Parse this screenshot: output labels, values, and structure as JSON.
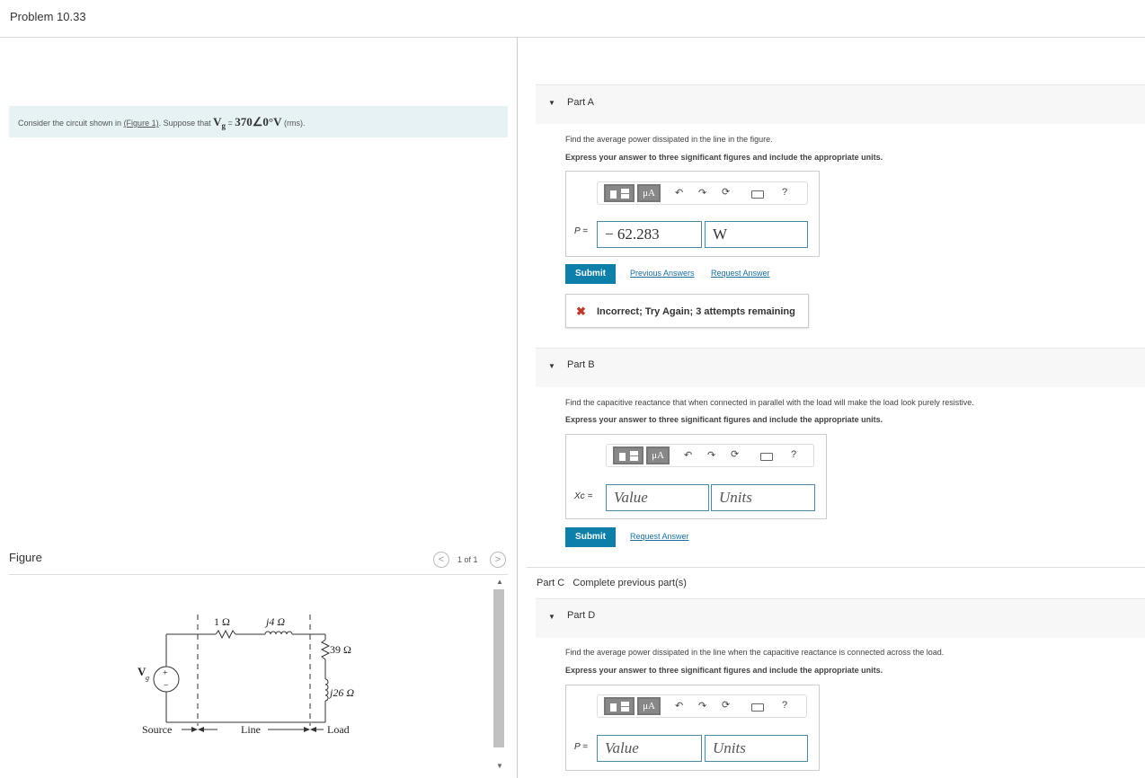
{
  "page": {
    "title": "Problem 10.33"
  },
  "problem": {
    "prefix": "Consider the circuit shown in ",
    "figure_link": "(Figure 1)",
    "middle": ". Suppose that ",
    "vg_symbol": "V",
    "vg_sub": "g",
    "equals": " = ",
    "vg_value": "370∠0°V",
    "suffix": " (rms)."
  },
  "figure": {
    "title": "Figure",
    "count": "1 of 1",
    "circuit": {
      "r1": "1 Ω",
      "x1": "j4 Ω",
      "r2": "39 Ω",
      "x2": "j26 Ω",
      "vg": "V",
      "vg_sub": "g",
      "plus": "+",
      "minus": "−",
      "source": "Source",
      "line": "Line",
      "load": "Load"
    }
  },
  "icons": {
    "prev": "chevron-left-icon",
    "next": "chevron-right-icon",
    "undo": "undo-icon",
    "redo": "redo-icon",
    "reset": "reset-icon",
    "keyboard": "keyboard-icon",
    "help": "help-icon",
    "templates": "templates-icon",
    "units": "units-icon"
  },
  "toolbar": {
    "mu_label": "μA",
    "help_label": "?"
  },
  "partA": {
    "label": "Part A",
    "question": "Find the average power dissipated in the line in the figure.",
    "instruction": "Express your answer to three significant figures and include the appropriate units.",
    "var_label": "P =",
    "value": "− 62.283",
    "units": "W",
    "submit": "Submit",
    "previous_answers": "Previous Answers",
    "request_answer": "Request Answer",
    "feedback_icon": "✖",
    "feedback": "Incorrect; Try Again; 3 attempts remaining"
  },
  "partB": {
    "label": "Part B",
    "question": "Find the capacitive reactance that when connected in parallel with the load will make the load look purely resistive.",
    "instruction": "Express your answer to three significant figures and include the appropriate units.",
    "var_label": "Xc =",
    "value_placeholder": "Value",
    "units_placeholder": "Units",
    "submit": "Submit",
    "request_answer": "Request Answer"
  },
  "partC": {
    "label": "Part C",
    "status": "Complete previous part(s)"
  },
  "partD": {
    "label": "Part D",
    "question": "Find the average power dissipated in the line when the capacitive reactance is connected across the load.",
    "instruction": "Express your answer to three significant figures and include the appropriate units.",
    "var_label": "P =",
    "value_placeholder": "Value",
    "units_placeholder": "Units"
  }
}
